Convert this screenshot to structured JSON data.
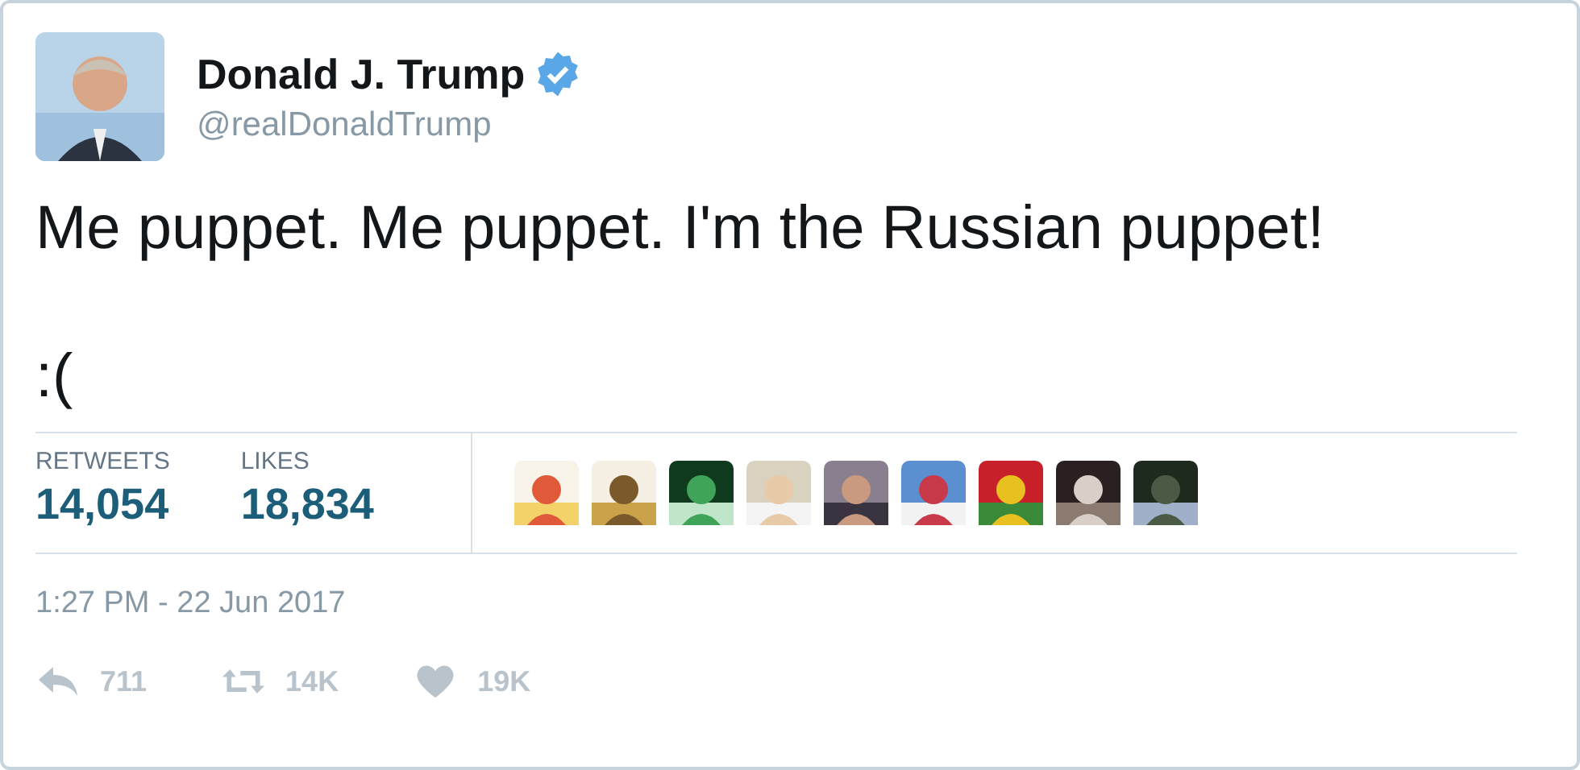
{
  "author": {
    "name": "Donald J. Trump",
    "verified": true,
    "handle": "@realDonaldTrump",
    "avatar": {
      "kind": "picture"
    }
  },
  "text_lines": [
    "Me puppet. Me puppet. I'm the Russian puppet!",
    ":("
  ],
  "stats": [
    {
      "label": "RETWEETS",
      "value": "14,054"
    },
    {
      "label": "LIKES",
      "value": "18,834"
    }
  ],
  "likers": [
    {
      "kind": "picture"
    },
    {
      "kind": "picture"
    },
    {
      "kind": "picture"
    },
    {
      "kind": "picture"
    },
    {
      "kind": "picture"
    },
    {
      "kind": "picture"
    },
    {
      "kind": "picture"
    },
    {
      "kind": "picture"
    },
    {
      "kind": "picture"
    }
  ],
  "timestamp": "1:27 PM - 22 Jun 2017",
  "actions": [
    {
      "kind": "reply",
      "count": "711"
    },
    {
      "kind": "retweet",
      "count": "14K"
    },
    {
      "kind": "like",
      "count": "19K"
    }
  ]
}
